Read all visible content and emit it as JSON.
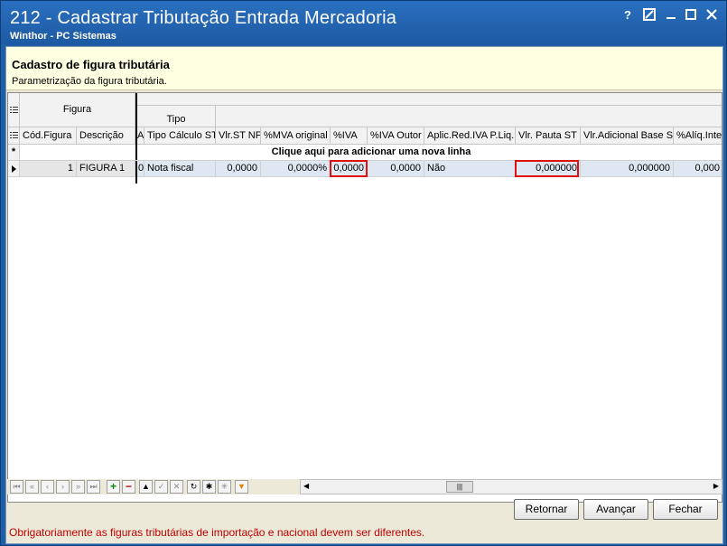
{
  "window": {
    "title": "212 - Cadastrar Tributação Entrada Mercadoria",
    "subtitle": "Winthor - PC Sistemas",
    "controls": {
      "help": "?",
      "restore": "⤢",
      "minimize": "‒",
      "maximize": "☐",
      "close": "✕"
    }
  },
  "info": {
    "heading": "Cadastro de figura tributária",
    "description": "Parametrização da figura tributária."
  },
  "grid": {
    "band_figura": "Figura",
    "band_tipo": "Tipo",
    "columns": {
      "cod": "Cód.Figura",
      "descricao": "Descrição",
      "a": "A",
      "tipo_calculo": "Tipo Cálculo ST",
      "vlr_st_nf": "Vlr.ST NF",
      "mva_original": "%MVA  original",
      "iva": "%IVA",
      "iva_outor": "%IVA Outor",
      "aplic_red": "Aplic.Red.IVA P.Liq.",
      "vlr_pauta": "Vlr. Pauta ST",
      "vlr_adicional": "Vlr.Adicional Base ST",
      "aliq_inte": "%Alíq.Inte"
    },
    "new_row_text": "Clique aqui para adicionar uma nova linha",
    "new_row_marker": "*",
    "row": {
      "cod": "1",
      "descricao": "FIGURA 1",
      "a": "0",
      "tipo_calculo": "Nota fiscal",
      "vlr_st_nf": "0,0000",
      "mva_original": "0,0000%",
      "iva": "0,0000",
      "iva_outor": "0,0000",
      "aplic_red": "Não",
      "vlr_pauta": "0,000000",
      "vlr_adicional": "0,000000",
      "aliq_inte": "0,000"
    }
  },
  "buttons": {
    "retornar": "Retornar",
    "avancar": "Avançar",
    "fechar": "Fechar"
  },
  "footer_message": "Obrigatoriamente as figuras tributárias de importação e nacional devem ser diferentes.",
  "colors": {
    "title_bar": "#1f5fa8",
    "info_bg": "#ffffe1",
    "error_text": "#c00000",
    "highlight": "#e01010"
  }
}
